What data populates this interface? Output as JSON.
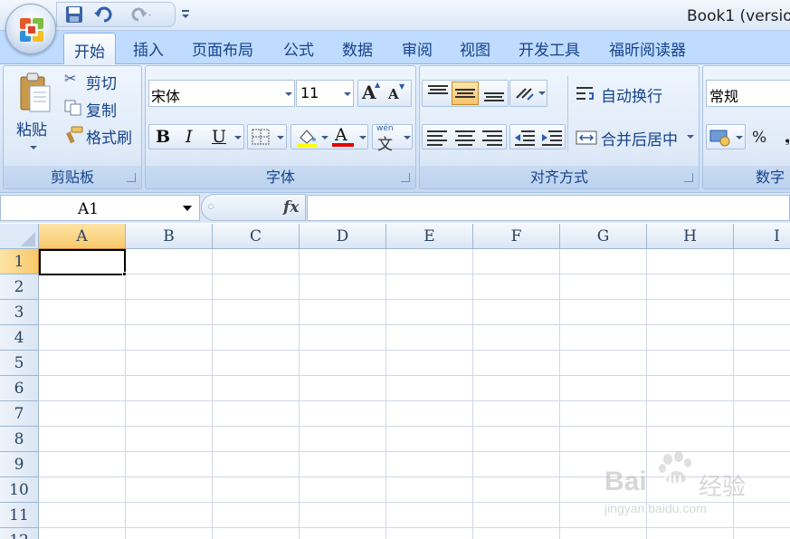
{
  "window": {
    "title": "Book1 (versio"
  },
  "quick_access": {
    "items": [
      "save-icon",
      "undo-icon",
      "redo-icon",
      "customize-icon"
    ]
  },
  "tabs": [
    "开始",
    "插入",
    "页面布局",
    "公式",
    "数据",
    "审阅",
    "视图",
    "开发工具",
    "福昕阅读器"
  ],
  "clipboard": {
    "paste": "粘贴",
    "cut": "剪切",
    "copy": "复制",
    "format_painter": "格式刷",
    "label": "剪贴板"
  },
  "font": {
    "name": "宋体",
    "size": "11",
    "bold": "B",
    "italic": "I",
    "underline": "U",
    "font_color_glyph": "A",
    "wen": "wén",
    "wen_char": "文",
    "label": "字体"
  },
  "alignment": {
    "wrap_text": "自动换行",
    "merge_center": "合并后居中",
    "label": "对齐方式"
  },
  "number": {
    "format": "常规",
    "percent": "%",
    "label": "数字"
  },
  "formula_bar": {
    "name_box": "A1",
    "fx": "fx",
    "formula": ""
  },
  "columns": [
    "A",
    "B",
    "C",
    "D",
    "E",
    "F",
    "G",
    "H",
    "I"
  ],
  "rows": [
    "1",
    "2",
    "3",
    "4",
    "5",
    "6",
    "7",
    "8",
    "9",
    "10",
    "11",
    "12"
  ],
  "selection": {
    "cell": "A1"
  },
  "watermark": {
    "brand": "Bai",
    "brand2": "du",
    "cn": "经验",
    "url": "jingyan.baidu.com"
  },
  "colors": {
    "ribbon": "#dae7f8",
    "tab_text": "#15428b",
    "selected_header": "#f8c96a",
    "fill_yellow": "#ffff00",
    "font_red": "#e00000"
  }
}
